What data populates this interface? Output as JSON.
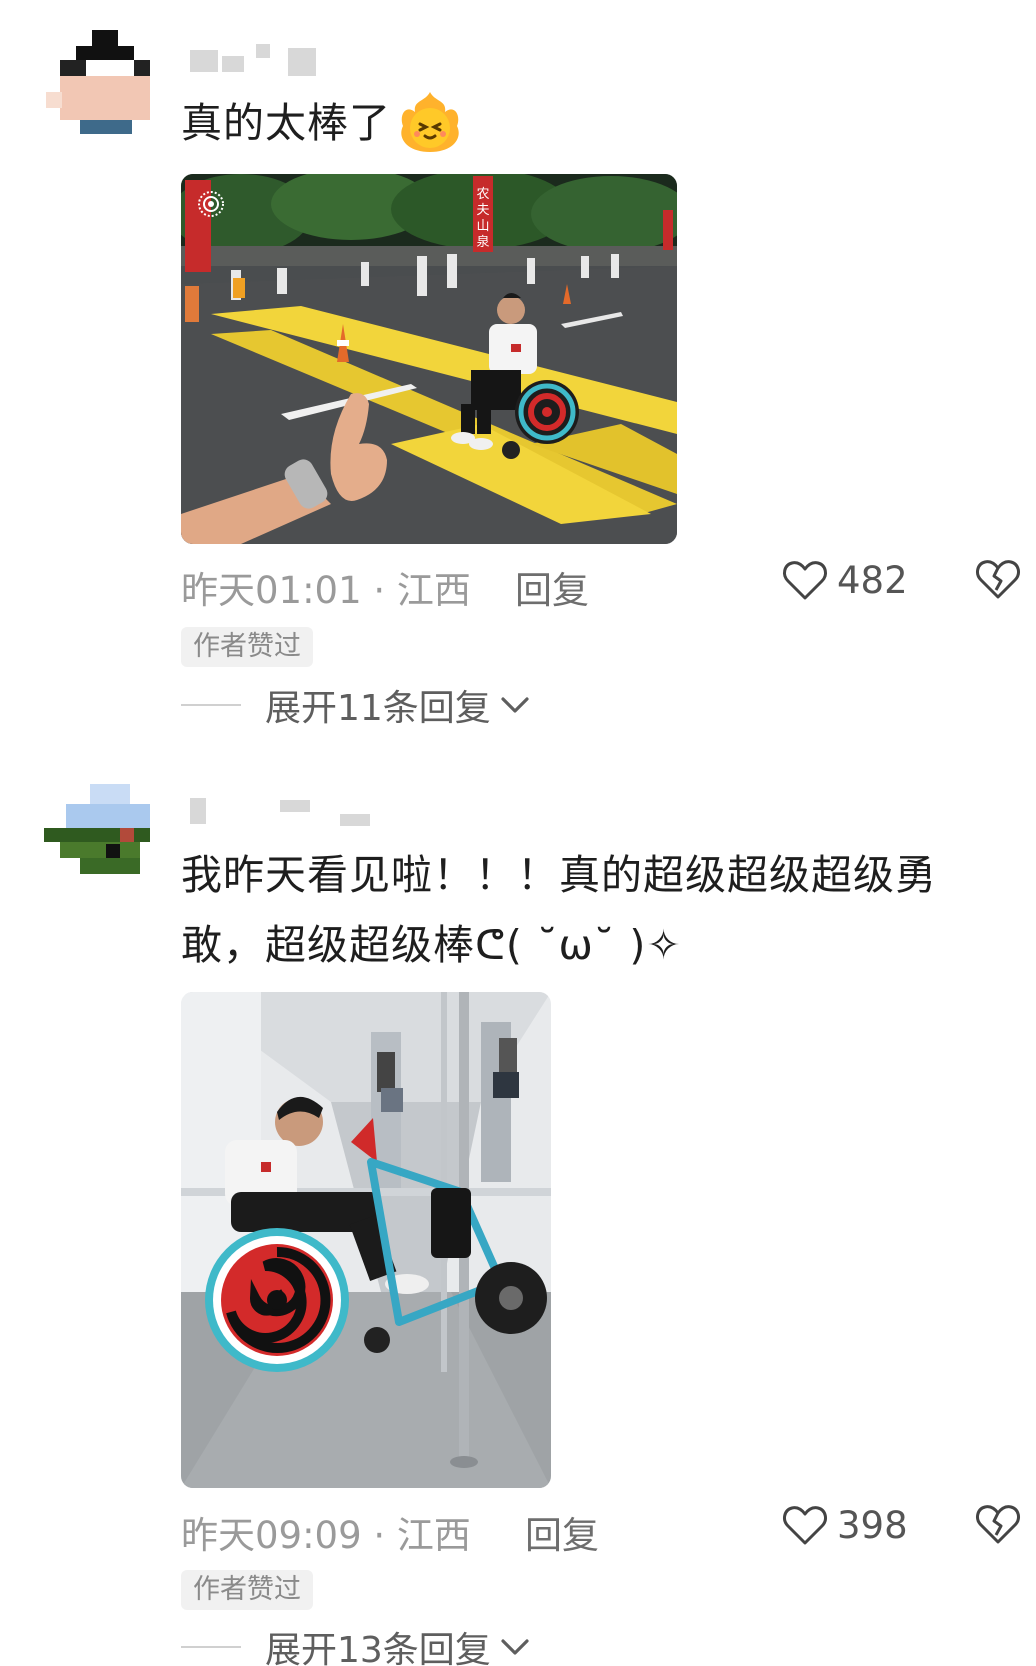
{
  "comments": [
    {
      "text": "真的太棒了",
      "emoji": "fire-face-emoji",
      "time": "昨天01:01 · 江西",
      "reply_label": "回复",
      "likes": "482",
      "badge": "作者赞过",
      "expand_label": "展开11条回复",
      "photo_signs": [
        "农夫山泉"
      ]
    },
    {
      "text": "我昨天看见啦！！！真的超级超级超级勇敢，超级超级棒ᕦ( ˘ω˘ )✧",
      "time": "昨天09:09 · 江西",
      "reply_label": "回复",
      "likes": "398",
      "badge": "作者赞过",
      "expand_label": "展开13条回复"
    }
  ],
  "colors": {
    "meta_text": "#9a9a9a",
    "reply_text": "#6e6e6e",
    "badge_bg": "#f1f1f1",
    "road_yellow": "#f2d53b",
    "wheel_teal": "#3fb9c9",
    "wheel_red": "#d32a2a"
  },
  "icons": {
    "like": "heart-outline-icon",
    "dislike": "broken-heart-icon",
    "expand": "chevron-down-icon",
    "photo_live": "live-photo-icon"
  }
}
